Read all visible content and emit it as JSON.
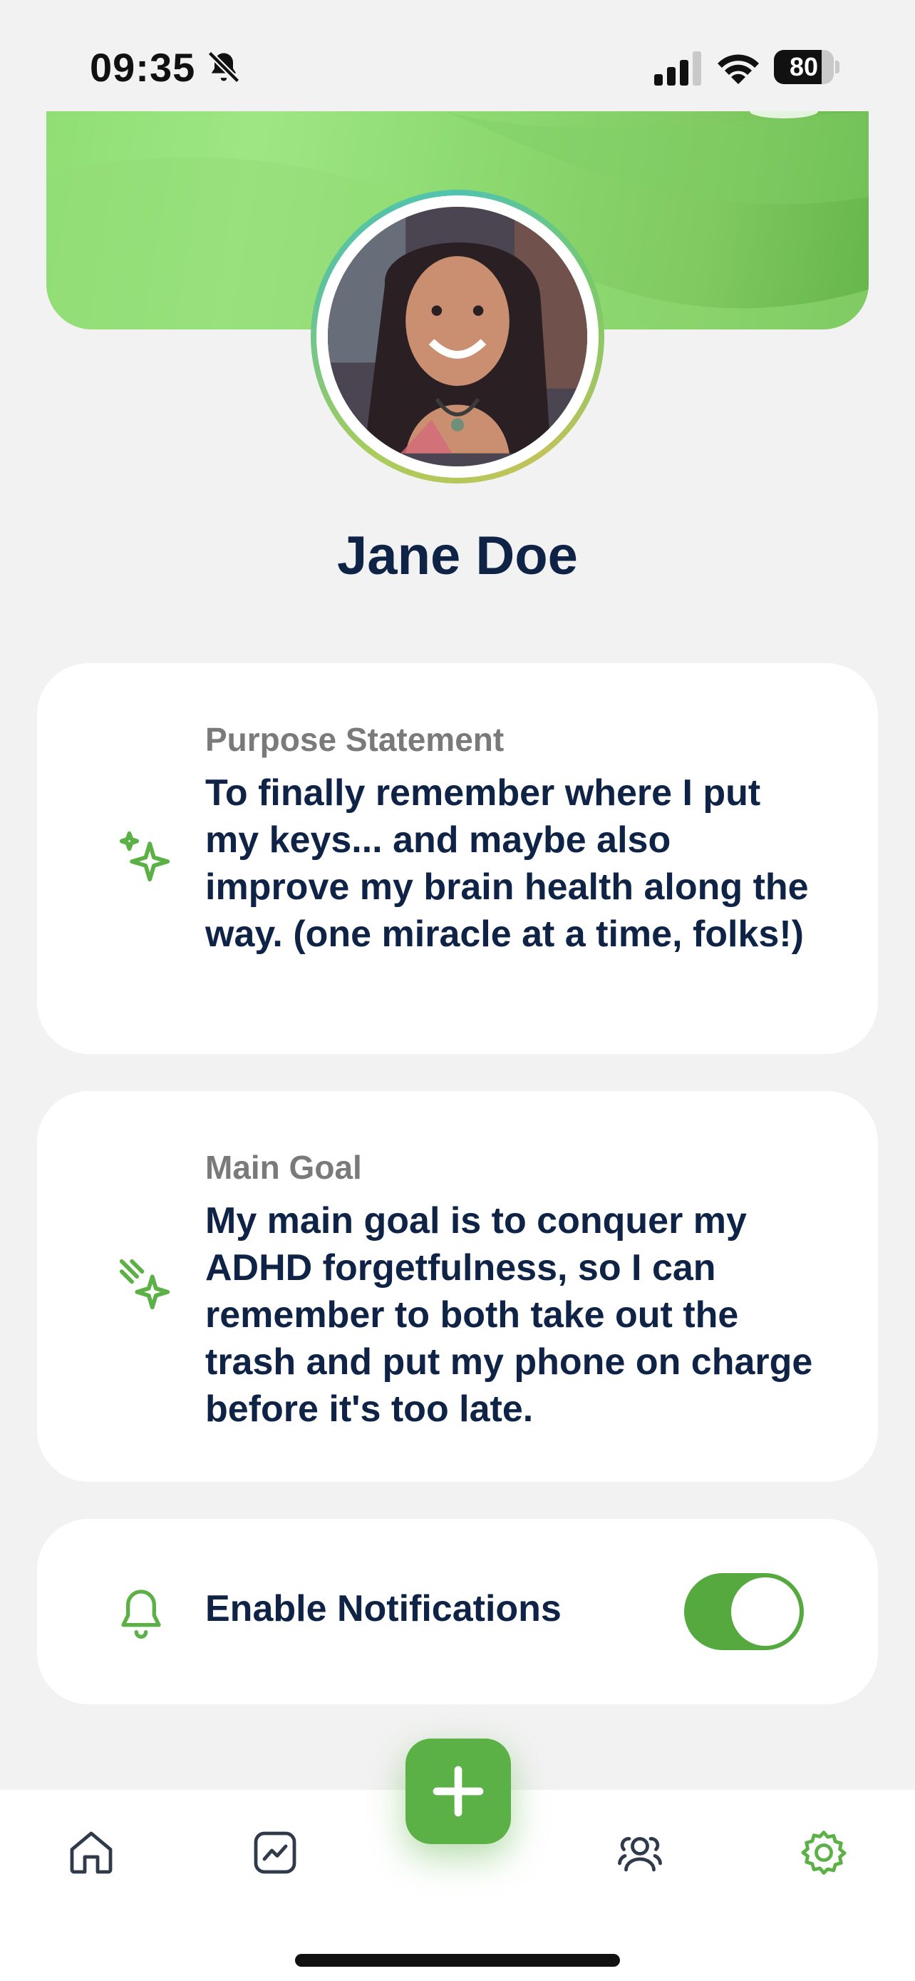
{
  "status_bar": {
    "time": "09:35",
    "battery_level": "80",
    "icons": [
      "bell-slash-icon",
      "cellular-signal-icon",
      "wifi-icon",
      "battery-icon"
    ]
  },
  "profile": {
    "name": "Jane Doe",
    "avatar_icon": "profile-photo",
    "banner_color": "#8fdf74"
  },
  "purpose": {
    "label": "Purpose Statement",
    "text": "To finally remember where I put my keys... and maybe also improve my brain health along the way. (one miracle at a time, folks!)",
    "icon": "sparkles-icon"
  },
  "goal": {
    "label": "Main Goal",
    "text": "My main goal is to conquer my ADHD forgetfulness, so I can remember to both take out the trash and put my phone on charge before it's too late.",
    "icon": "shooting-star-icon"
  },
  "notifications": {
    "label": "Enable Notifications",
    "enabled": true,
    "icon": "bell-icon"
  },
  "tab_bar": {
    "items": [
      {
        "name": "home",
        "icon": "home-icon",
        "active": false
      },
      {
        "name": "progress",
        "icon": "chart-icon",
        "active": false
      },
      {
        "name": "community",
        "icon": "users-icon",
        "active": false
      },
      {
        "name": "settings",
        "icon": "gear-icon",
        "active": true
      }
    ],
    "fab_icon": "plus-icon"
  },
  "colors": {
    "accent": "#5bb145",
    "text_primary": "#0f2347",
    "text_secondary": "#7a7a7a",
    "background": "#f2f2f2"
  }
}
